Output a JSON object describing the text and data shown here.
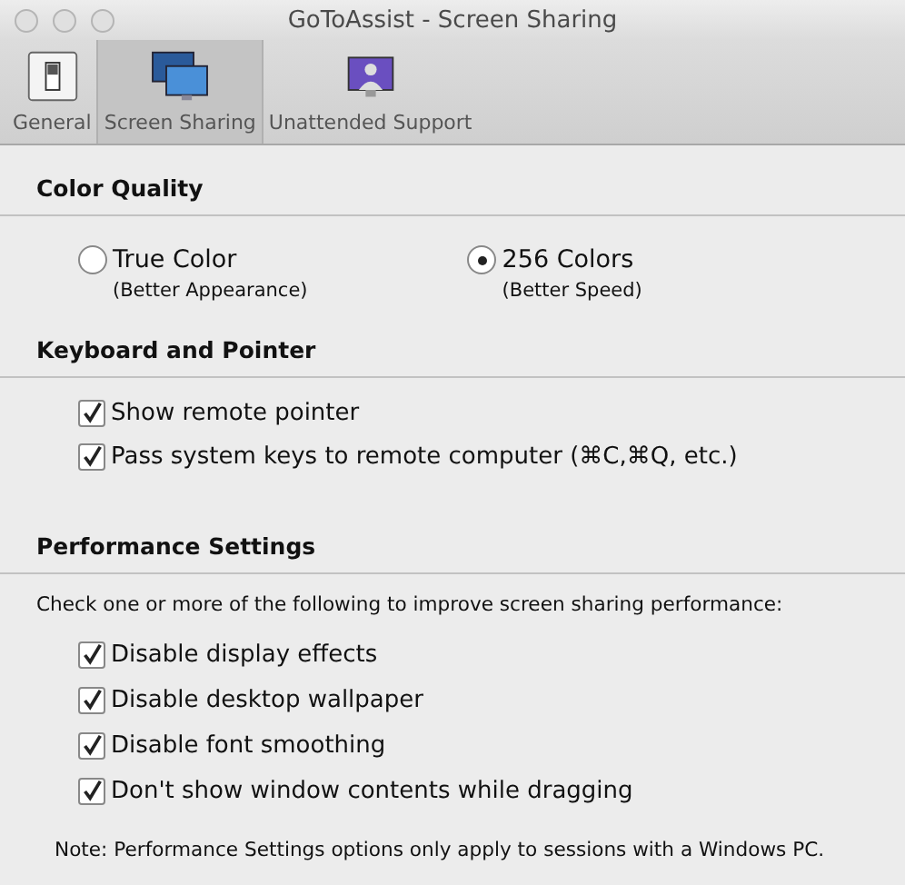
{
  "window": {
    "title": "GoToAssist - Screen Sharing"
  },
  "tabs": [
    {
      "label": "General",
      "kind": "switch",
      "selected": false
    },
    {
      "label": "Screen Sharing",
      "kind": "monitors",
      "selected": true
    },
    {
      "label": "Unattended Support",
      "kind": "person",
      "selected": false
    }
  ],
  "color_quality": {
    "heading": "Color Quality",
    "options": [
      {
        "label": "True Color",
        "sublabel": "(Better Appearance)",
        "selected": false
      },
      {
        "label": "256 Colors",
        "sublabel": "(Better Speed)",
        "selected": true
      }
    ]
  },
  "keyboard_pointer": {
    "heading": "Keyboard and Pointer",
    "options": [
      {
        "label": "Show remote pointer",
        "checked": true
      },
      {
        "label": "Pass system keys to remote computer (⌘C,⌘Q, etc.)",
        "checked": true
      }
    ]
  },
  "performance": {
    "heading": "Performance Settings",
    "description": "Check one or more of the following to improve screen sharing performance:",
    "options": [
      {
        "label": "Disable display effects",
        "checked": true
      },
      {
        "label": "Disable desktop wallpaper",
        "checked": true
      },
      {
        "label": "Disable font smoothing",
        "checked": true
      },
      {
        "label": "Don't show window contents while dragging",
        "checked": true
      }
    ],
    "note": "Note: Performance Settings options only apply to sessions with a Windows PC."
  }
}
